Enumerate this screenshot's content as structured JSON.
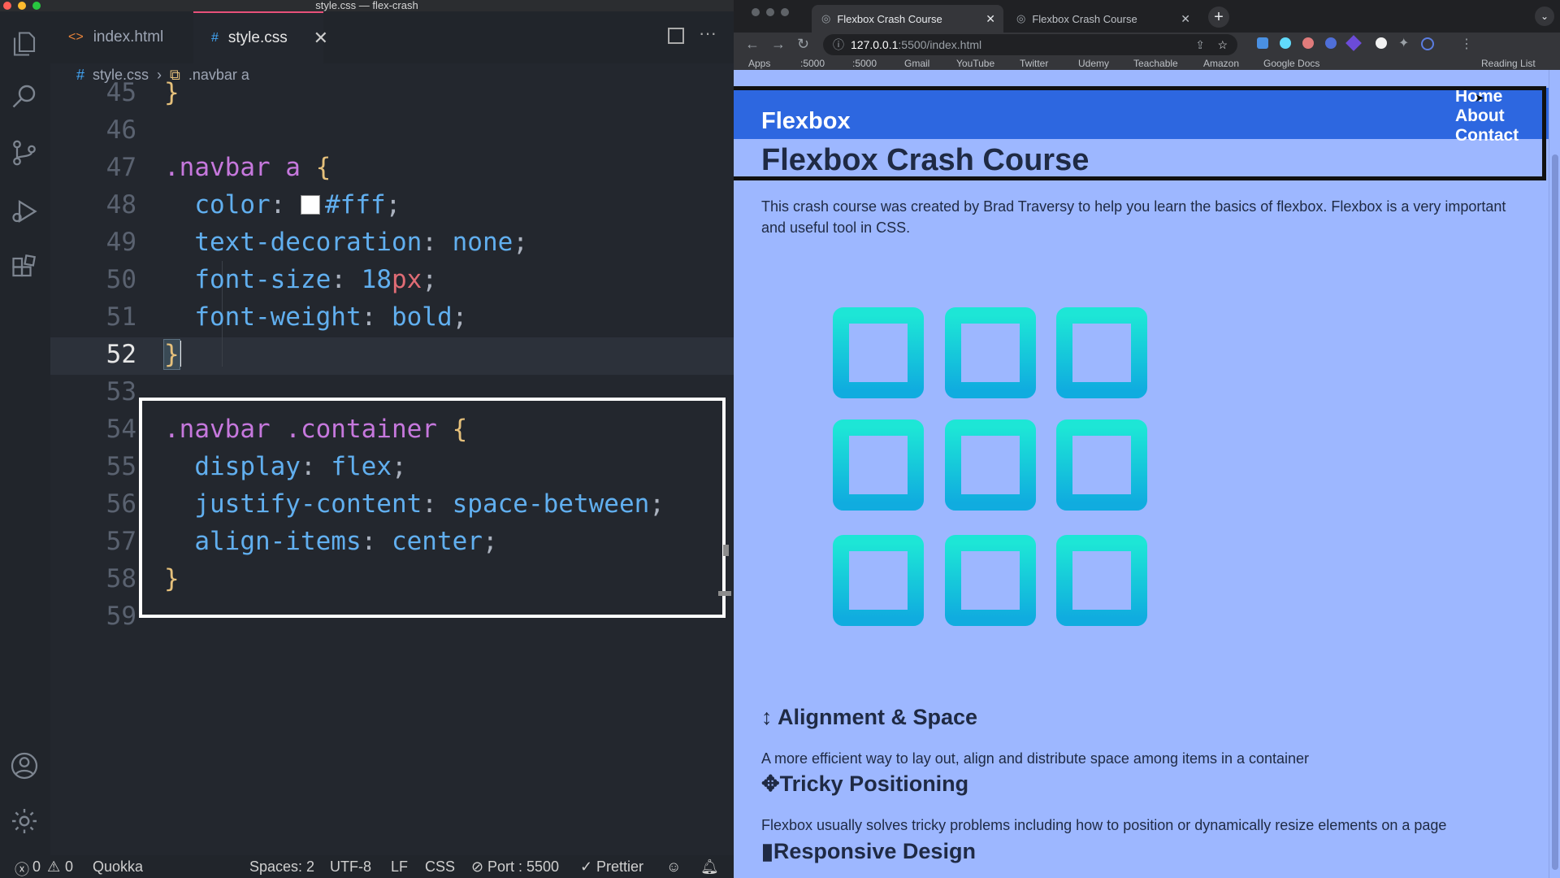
{
  "vscode": {
    "window_title": "style.css — flex-crash",
    "tabs": [
      {
        "label": "index.html",
        "icon": "<>"
      },
      {
        "label": "style.css",
        "icon": "#"
      }
    ],
    "breadcrumb": {
      "file": "style.css",
      "symbol": ".navbar a"
    },
    "line_numbers": [
      "45",
      "46",
      "47",
      "48",
      "49",
      "50",
      "51",
      "52",
      "53",
      "54",
      "55",
      "56",
      "57",
      "58",
      "59"
    ],
    "code": {
      "l45_brace": "}",
      "l47_selector": ".navbar a",
      "l47_brace": "{",
      "l48_prop": "color",
      "l48_val": "#fff",
      "l49_prop": "text-decoration",
      "l49_val": "none",
      "l50_prop": "font-size",
      "l50_num": "18",
      "l50_unit": "px",
      "l51_prop": "font-weight",
      "l51_val": "bold",
      "l52_brace": "}",
      "l54_selector": ".navbar .container",
      "l54_brace": "{",
      "l55_prop": "display",
      "l55_val": "flex",
      "l56_prop": "justify-content",
      "l56_val": "space-between",
      "l57_prop": "align-items",
      "l57_val": "center",
      "l58_brace": "}"
    },
    "colon": ":",
    "semicolon": ";",
    "statusbar": {
      "errors": "0",
      "warnings": "0",
      "quokka": "Quokka",
      "spaces": "Spaces: 2",
      "encoding": "UTF-8",
      "eol": "LF",
      "language": "CSS",
      "port": "Port : 5500",
      "prettier": "Prettier"
    }
  },
  "browser": {
    "tabs": [
      {
        "title": "Flexbox Crash Course"
      },
      {
        "title": "Flexbox Crash Course"
      }
    ],
    "url_host": "127.0.0.1",
    "url_path": ":5500/index.html",
    "bookmarks": [
      "Apps",
      ":5000",
      ":5000",
      "Gmail",
      "YouTube",
      "Twitter",
      "Udemy",
      "Teachable",
      "Amazon",
      "Google Docs",
      "Reading List"
    ]
  },
  "page": {
    "brand": "Flexbox",
    "nav": [
      "Home",
      "About",
      "Contact"
    ],
    "title": "Flexbox Crash Course",
    "intro": "This crash course was created by Brad Traversy to help you learn the basics of flexbox. Flexbox is a very important and useful tool in CSS.",
    "sections": [
      {
        "icon": "↕",
        "heading": "Alignment & Space",
        "text": "A more efficient way to lay out, align and distribute space among items in a container"
      },
      {
        "icon": "✥",
        "heading": "Tricky Positioning",
        "text": "Flexbox usually solves tricky problems including how to position or dynamically resize elements on a page"
      },
      {
        "icon": "▮",
        "heading": "Responsive Design",
        "text": ""
      }
    ]
  },
  "colors": {
    "accent_tab": "#e8507a",
    "navbar_bg": "#2d67e0",
    "page_bg": "#9db7ff",
    "grid_top": "#1de6d6",
    "grid_bottom": "#10acdf"
  }
}
